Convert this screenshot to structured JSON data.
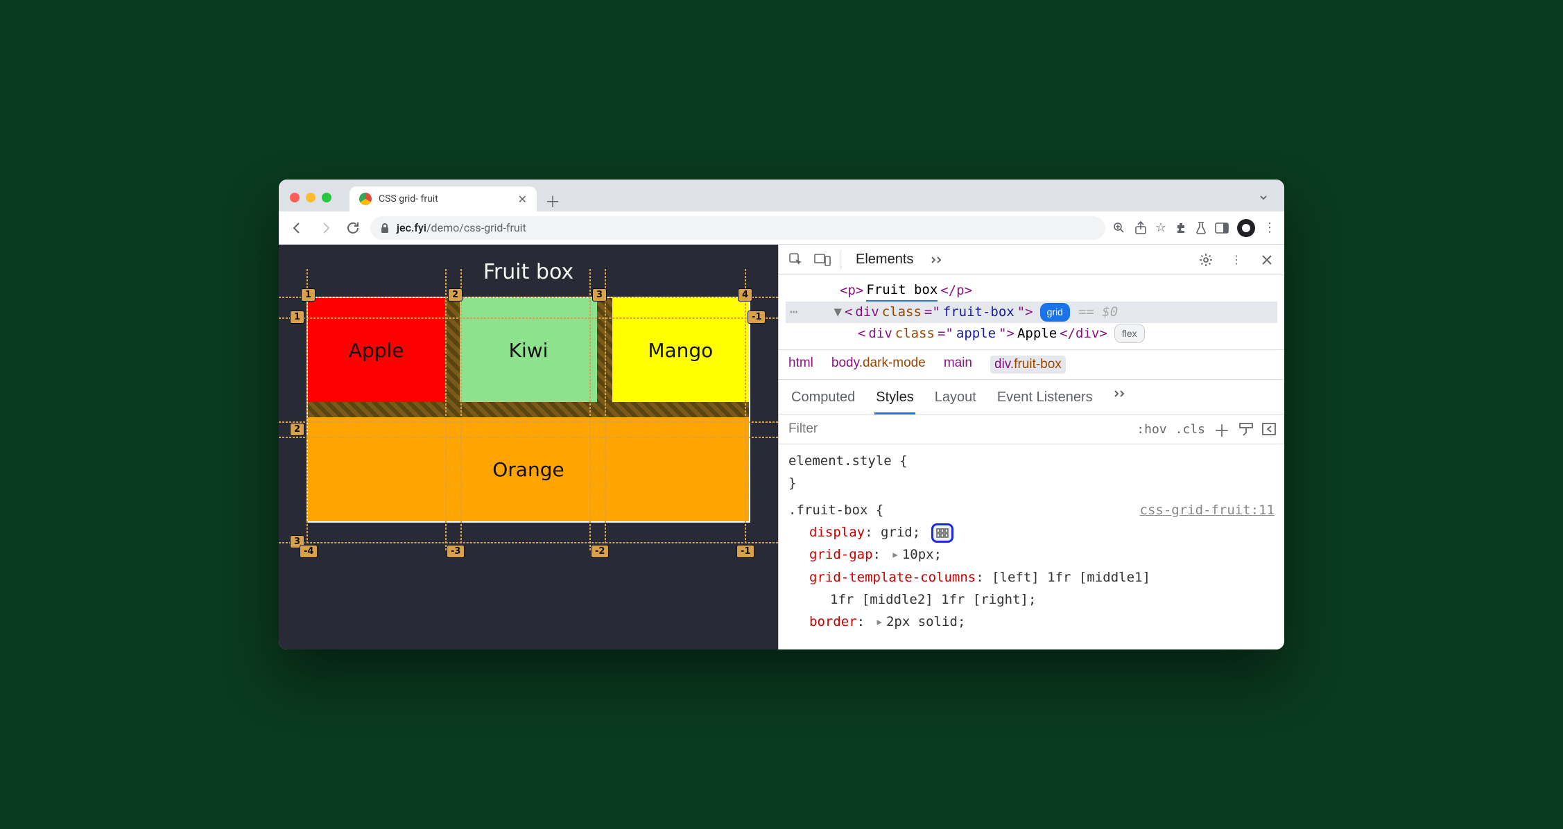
{
  "tab": {
    "title": "CSS grid- fruit"
  },
  "url": {
    "host": "jec.fyi",
    "path": "/demo/css-grid-fruit"
  },
  "page": {
    "heading": "Fruit box",
    "cells": {
      "apple": "Apple",
      "kiwi": "Kiwi",
      "mango": "Mango",
      "orange": "Orange"
    },
    "gridNumbers": {
      "colsTop": [
        "1",
        "2",
        "3",
        "4"
      ],
      "rowsLeft": [
        "1",
        "2",
        "3"
      ],
      "rowRightNeg": "-1",
      "colsBottom": [
        "-4",
        "-3",
        "-2",
        "-1"
      ]
    }
  },
  "devtools": {
    "mainTabs": {
      "elements": "Elements"
    },
    "dom": {
      "pOpen": "<p>",
      "pText": "Fruit box",
      "pClose": "</p>",
      "div1a": "<",
      "div1b": "div ",
      "div1c": "class",
      "div1d": "=\"",
      "div1e": "fruit-box",
      "div1f": "\">",
      "gridBadge": "grid",
      "eq0": "== $0",
      "div2a": "<",
      "div2b": "div ",
      "div2c": "class",
      "div2d": "=\"",
      "div2e": "apple",
      "div2f": "\">",
      "div2text": "Apple",
      "div2close": "</div>",
      "flexBadge": "flex"
    },
    "crumbs": {
      "html": "html",
      "body": "body",
      "bodyCls": ".dark-mode",
      "main": "main",
      "div": "div",
      "divCls": ".fruit-box"
    },
    "subtabs": {
      "computed": "Computed",
      "styles": "Styles",
      "layout": "Layout",
      "listeners": "Event Listeners"
    },
    "filter": {
      "placeholder": "Filter",
      "hov": ":hov",
      "cls": ".cls"
    },
    "rules": {
      "elStyleOpen": "element.style {",
      "close": "}",
      "selector": ".fruit-box {",
      "source": "css-grid-fruit:11",
      "display": {
        "prop": "display",
        "val": "grid"
      },
      "gap": {
        "prop": "grid-gap",
        "val": "10px"
      },
      "cols": {
        "prop": "grid-template-columns",
        "val": "[left] 1fr [middle1]",
        "val2": "1fr [middle2] 1fr [right]"
      },
      "border": {
        "prop": "border",
        "val": "2px solid"
      },
      "semi": ";",
      "colon": ": "
    }
  }
}
